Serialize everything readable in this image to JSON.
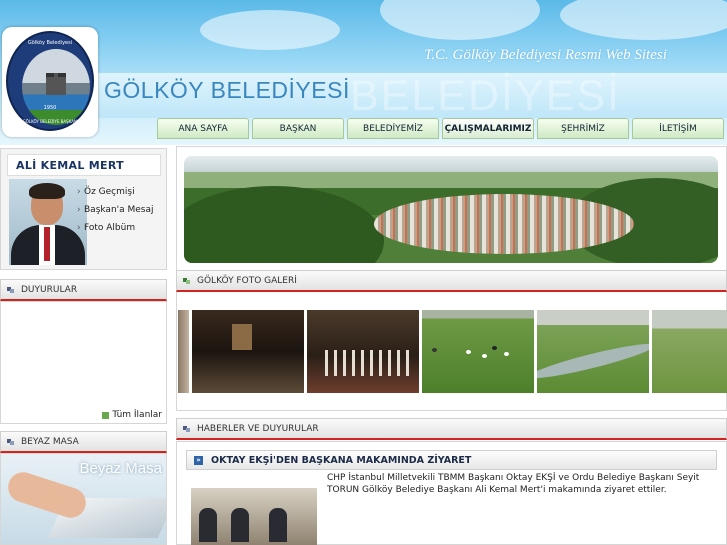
{
  "header": {
    "site_subtitle": "T.C. Gölköy Belediyesi Resmi Web Sitesi",
    "site_title": "GÖLKÖY  BELEDİYESİ",
    "site_title_ghost": "BELEDİYESİ",
    "logo": {
      "top_text": "Gölköy Belediyesi",
      "year": "1950",
      "bottom_text": "T.C.GÖLKÖY BELEDİYE BAŞKANLIĞI"
    }
  },
  "nav": {
    "items": [
      {
        "label": "ANA SAYFA",
        "active": false
      },
      {
        "label": "BAŞKAN",
        "active": false
      },
      {
        "label": "BELEDİYEMİZ",
        "active": false
      },
      {
        "label": "ÇALIŞMALARIMIZ",
        "active": true
      },
      {
        "label": "ŞEHRİMİZ",
        "active": false
      },
      {
        "label": "İLETİŞİM",
        "active": false
      }
    ]
  },
  "mayor": {
    "name": "ALİ KEMAL MERT",
    "links": [
      "Öz Geçmişi",
      "Başkan'a Mesaj",
      "Foto Albüm"
    ]
  },
  "announcements": {
    "title": "DUYURULAR",
    "all_link": "Tüm İlanlar"
  },
  "white_desk": {
    "title": "BEYAZ MASA",
    "image_text": "Beyaz Masa"
  },
  "gallery": {
    "title": "GÖLKÖY FOTO GALERİ"
  },
  "news": {
    "title": "HABERLER VE DUYURULAR",
    "item_title": "OKTAY EKŞİ'DEN BAŞKANA MAKAMINDA ZİYARET",
    "item_text": "CHP İstanbul Milletvekili TBMM Başkanı Oktay EKŞİ ve Ordu Belediye Başkanı Seyit TORUN Gölköy Belediye Başkanı Ali Kemal Mert'i makamında ziyaret ettiler."
  },
  "colors": {
    "accent_red": "#d2231e",
    "nav_green": "#cfe9c4",
    "header_blue": "#5ab9e8",
    "title_blue": "#3a87bf"
  },
  "icons": {
    "news_bullet": "arrow-right-icon",
    "panel_bullet": "square-bullet-icon",
    "link_bullet": "chevron-right-icon"
  }
}
